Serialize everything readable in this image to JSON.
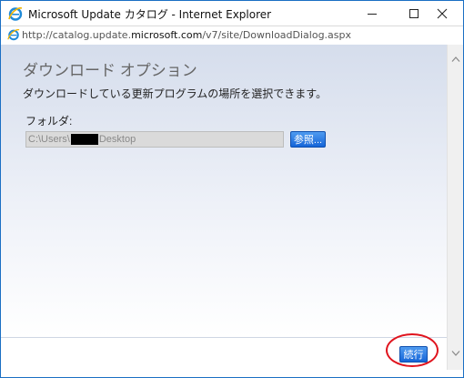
{
  "window": {
    "title": "Microsoft Update カタログ - Internet Explorer",
    "minimize_icon": "minimize-icon",
    "maximize_icon": "maximize-icon",
    "close_icon": "close-icon"
  },
  "address": {
    "prefix": "http://catalog.update.",
    "domain": "microsoft.com",
    "suffix": "/v7/site/DownloadDialog.aspx"
  },
  "dialog": {
    "title": "ダウンロード オプション",
    "description": "ダウンロードしている更新プログラムの場所を選択できます。",
    "folder_label": "フォルダ:",
    "folder_value_start": "C:\\Users\\",
    "folder_value_end": "Desktop",
    "browse_label": "参照...",
    "continue_label": "続行"
  },
  "colors": {
    "accent": "#1565d8",
    "highlight": "#e0141e",
    "border": "#1b6fc4"
  }
}
